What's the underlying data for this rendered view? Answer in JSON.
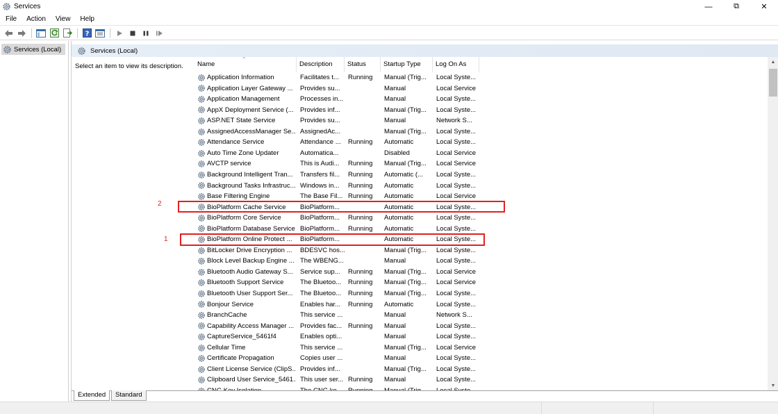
{
  "window": {
    "title": "Services"
  },
  "menu": [
    "File",
    "Action",
    "View",
    "Help"
  ],
  "tree": {
    "root_label": "Services (Local)"
  },
  "pane": {
    "header_title": "Services (Local)",
    "description_prompt": "Select an item to view its description."
  },
  "columns": {
    "name": "Name",
    "description": "Description",
    "status": "Status",
    "startup": "Startup Type",
    "logon": "Log On As"
  },
  "rows": [
    {
      "name": "Application Information",
      "description": "Facilitates t...",
      "status": "Running",
      "startup": "Manual (Trig...",
      "logon": "Local Syste..."
    },
    {
      "name": "Application Layer Gateway ...",
      "description": "Provides su...",
      "status": "",
      "startup": "Manual",
      "logon": "Local Service"
    },
    {
      "name": "Application Management",
      "description": "Processes in...",
      "status": "",
      "startup": "Manual",
      "logon": "Local Syste..."
    },
    {
      "name": "AppX Deployment Service (...",
      "description": "Provides inf...",
      "status": "",
      "startup": "Manual (Trig...",
      "logon": "Local Syste..."
    },
    {
      "name": "ASP.NET State Service",
      "description": "Provides su...",
      "status": "",
      "startup": "Manual",
      "logon": "Network S..."
    },
    {
      "name": "AssignedAccessManager Se...",
      "description": "AssignedAc...",
      "status": "",
      "startup": "Manual (Trig...",
      "logon": "Local Syste..."
    },
    {
      "name": "Attendance Service",
      "description": "Attendance ...",
      "status": "Running",
      "startup": "Automatic",
      "logon": "Local Syste..."
    },
    {
      "name": "Auto Time Zone Updater",
      "description": "Automatica...",
      "status": "",
      "startup": "Disabled",
      "logon": "Local Service"
    },
    {
      "name": "AVCTP service",
      "description": "This is Audi...",
      "status": "Running",
      "startup": "Manual (Trig...",
      "logon": "Local Service"
    },
    {
      "name": "Background Intelligent Tran...",
      "description": "Transfers fil...",
      "status": "Running",
      "startup": "Automatic (...",
      "logon": "Local Syste..."
    },
    {
      "name": "Background Tasks Infrastruc...",
      "description": "Windows in...",
      "status": "Running",
      "startup": "Automatic",
      "logon": "Local Syste..."
    },
    {
      "name": "Base Filtering Engine",
      "description": "The Base Fil...",
      "status": "Running",
      "startup": "Automatic",
      "logon": "Local Service"
    },
    {
      "name": "BioPlatform Cache Service",
      "description": "BioPlatform...",
      "status": "",
      "startup": "Automatic",
      "logon": "Local Syste..."
    },
    {
      "name": "BioPlatform Core Service",
      "description": "BioPlatform...",
      "status": "Running",
      "startup": "Automatic",
      "logon": "Local Syste..."
    },
    {
      "name": "BioPlatform Database Service",
      "description": "BioPlatform...",
      "status": "Running",
      "startup": "Automatic",
      "logon": "Local Syste..."
    },
    {
      "name": "BioPlatform Online Protect ...",
      "description": "BioPlatform...",
      "status": "",
      "startup": "Automatic",
      "logon": "Local Syste..."
    },
    {
      "name": "BitLocker Drive Encryption ...",
      "description": "BDESVC hos...",
      "status": "",
      "startup": "Manual (Trig...",
      "logon": "Local Syste..."
    },
    {
      "name": "Block Level Backup Engine ...",
      "description": "The WBENG...",
      "status": "",
      "startup": "Manual",
      "logon": "Local Syste..."
    },
    {
      "name": "Bluetooth Audio Gateway S...",
      "description": "Service sup...",
      "status": "Running",
      "startup": "Manual (Trig...",
      "logon": "Local Service"
    },
    {
      "name": "Bluetooth Support Service",
      "description": "The Bluetoo...",
      "status": "Running",
      "startup": "Manual (Trig...",
      "logon": "Local Service"
    },
    {
      "name": "Bluetooth User Support Ser...",
      "description": "The Bluetoo...",
      "status": "Running",
      "startup": "Manual (Trig...",
      "logon": "Local Syste..."
    },
    {
      "name": "Bonjour Service",
      "description": "Enables har...",
      "status": "Running",
      "startup": "Automatic",
      "logon": "Local Syste..."
    },
    {
      "name": "BranchCache",
      "description": "This service ...",
      "status": "",
      "startup": "Manual",
      "logon": "Network S..."
    },
    {
      "name": "Capability Access Manager ...",
      "description": "Provides fac...",
      "status": "Running",
      "startup": "Manual",
      "logon": "Local Syste..."
    },
    {
      "name": "CaptureService_5461f4",
      "description": "Enables opti...",
      "status": "",
      "startup": "Manual",
      "logon": "Local Syste..."
    },
    {
      "name": "Cellular Time",
      "description": "This service ...",
      "status": "",
      "startup": "Manual (Trig...",
      "logon": "Local Service"
    },
    {
      "name": "Certificate Propagation",
      "description": "Copies user ...",
      "status": "",
      "startup": "Manual",
      "logon": "Local Syste..."
    },
    {
      "name": "Client License Service (ClipS...",
      "description": "Provides inf...",
      "status": "",
      "startup": "Manual (Trig...",
      "logon": "Local Syste..."
    },
    {
      "name": "Clipboard User Service_5461...",
      "description": "This user ser...",
      "status": "Running",
      "startup": "Manual",
      "logon": "Local Syste..."
    },
    {
      "name": "CNG Key Isolation",
      "description": "The CNG ke...",
      "status": "Running",
      "startup": "Manual (Trig...",
      "logon": "Local Syste..."
    }
  ],
  "tabs": {
    "extended": "Extended",
    "standard": "Standard"
  },
  "annotations": {
    "label_1": "1",
    "label_2": "2",
    "color": "#e02020"
  }
}
